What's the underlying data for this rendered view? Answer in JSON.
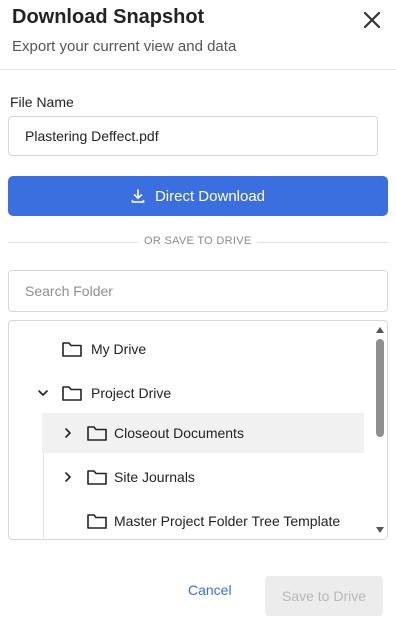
{
  "dialog": {
    "title": "Download Snapshot",
    "subtitle": "Export your current view and data"
  },
  "file": {
    "label": "File Name",
    "value": "Plastering Deffect.pdf"
  },
  "direct_download": {
    "label": "Direct Download"
  },
  "divider": {
    "label": "OR SAVE TO DRIVE"
  },
  "search": {
    "placeholder": "Search Folder"
  },
  "tree": {
    "items": [
      {
        "label": "My Drive",
        "expandable": false
      },
      {
        "label": "Project Drive",
        "expandable": true,
        "expanded": true
      },
      {
        "label": "Closeout Documents",
        "expandable": true,
        "expanded": false,
        "selected": true
      },
      {
        "label": "Site Journals",
        "expandable": true,
        "expanded": false
      },
      {
        "label": "Master Project Folder Tree Template",
        "expandable": false
      }
    ]
  },
  "footer": {
    "cancel_label": "Cancel",
    "save_label": "Save to Drive"
  },
  "colors": {
    "primary": "#3b6fe0",
    "disabled_bg": "#ececec",
    "disabled_text": "#b8b8b8"
  }
}
